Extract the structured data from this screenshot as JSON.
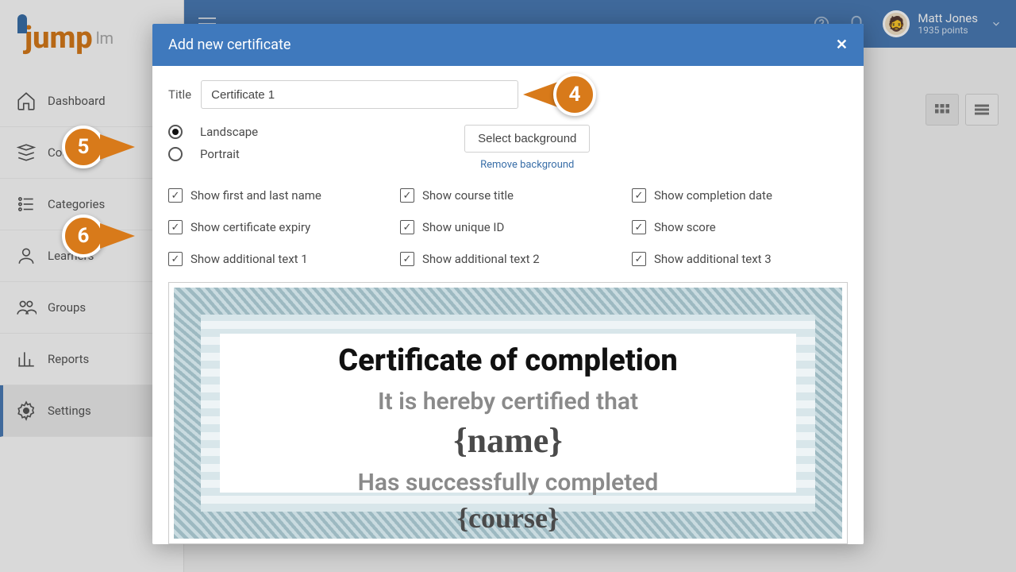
{
  "brand": {
    "name": "jump",
    "suffix": "lm"
  },
  "topbar": {
    "user_name": "Matt Jones",
    "user_points": "1935 points"
  },
  "sidebar": {
    "items": [
      {
        "label": "Dashboard"
      },
      {
        "label": "Courses"
      },
      {
        "label": "Categories"
      },
      {
        "label": "Learners"
      },
      {
        "label": "Groups"
      },
      {
        "label": "Reports"
      },
      {
        "label": "Settings"
      }
    ]
  },
  "modal": {
    "title": "Add new certificate",
    "title_field_label": "Title",
    "title_value": "Certificate 1",
    "orientation": {
      "landscape": "Landscape",
      "portrait": "Portrait"
    },
    "bg": {
      "select": "Select background",
      "remove": "Remove background"
    },
    "checks": [
      {
        "label": "Show first and last name"
      },
      {
        "label": "Show course title"
      },
      {
        "label": "Show completion date"
      },
      {
        "label": "Show certificate expiry"
      },
      {
        "label": "Show unique ID"
      },
      {
        "label": "Show score"
      },
      {
        "label": "Show additional text 1"
      },
      {
        "label": "Show additional text 2"
      },
      {
        "label": "Show additional text 3"
      }
    ],
    "preview": {
      "heading": "Certificate of completion",
      "sub1": "It is hereby certified that",
      "name": "{name}",
      "sub2": "Has successfully completed",
      "course": "{course}"
    }
  },
  "callouts": {
    "c4": "4",
    "c5": "5",
    "c6": "6"
  }
}
